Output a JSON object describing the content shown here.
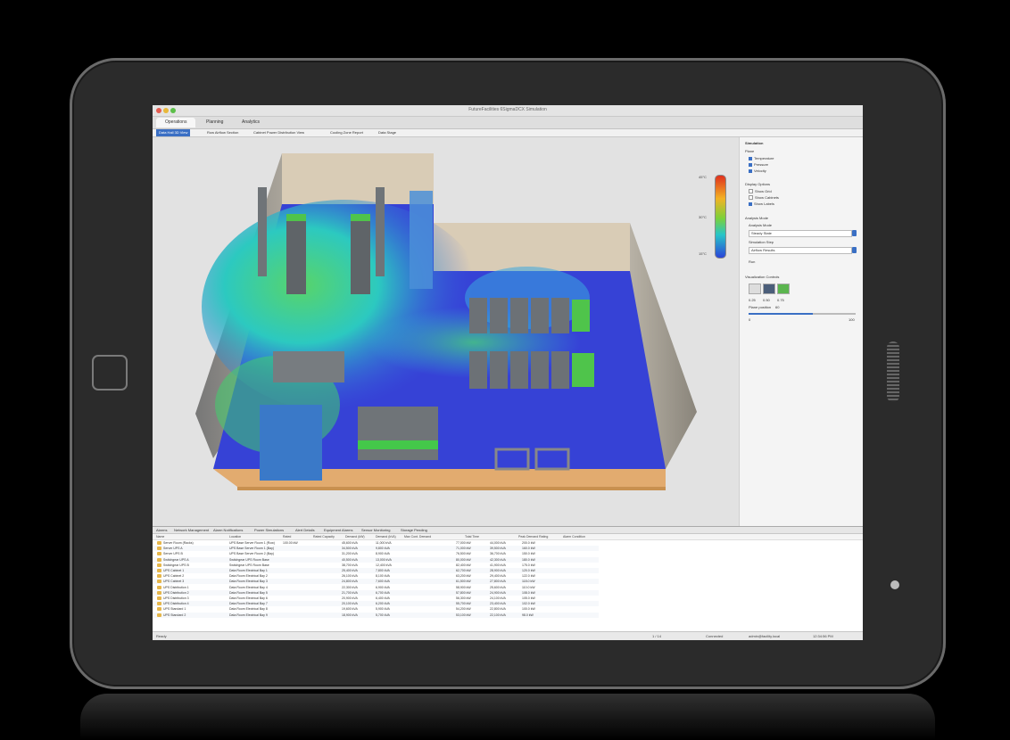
{
  "app": {
    "title": "FutureFacilities 6SigmaDCX Simulation"
  },
  "tabs": [
    {
      "label": "Operations"
    },
    {
      "label": "Planning"
    },
    {
      "label": "Analytics"
    }
  ],
  "subtabs": [
    {
      "label": "Data Hall 3D View"
    },
    {
      "label": "Row Airflow Section"
    },
    {
      "label": "Cabinet Power Distribution View"
    },
    {
      "label": "Cooling Zone Report"
    },
    {
      "label": "Data Stage"
    }
  ],
  "legend": {
    "max": "45°C",
    "mid": "30°C",
    "min": "15°C"
  },
  "right_panel": {
    "heading": "Simulation",
    "group1_title": "Plane",
    "checks": [
      {
        "label": "Temperature",
        "checked": true
      },
      {
        "label": "Pressure",
        "checked": true
      },
      {
        "label": "Velocity",
        "checked": true
      }
    ],
    "group2_title": "Display Options",
    "checks2": [
      {
        "label": "Show Grid",
        "checked": false
      },
      {
        "label": "Show Cabinets",
        "checked": false
      },
      {
        "label": "Show Labels",
        "checked": true
      }
    ],
    "group3_title": "Analysis Mode",
    "field1_label": "Analysis Mode",
    "field1_value": "Steady State",
    "field2_label": "Simulation Step",
    "field2_value": "Airflow Results",
    "run_label": "Run",
    "group4_title": "Visualization Controls",
    "scale_labels": [
      "0.25",
      "0.50",
      "0.75"
    ],
    "plane_label": "Plane position",
    "plane_value": "60",
    "range_min": "0",
    "range_max": "100"
  },
  "bottom": {
    "tabs": [
      "Alarms",
      "Network Management",
      "Alarm Notifications",
      "Power Simulations",
      "Alert Details",
      "Equipment Alarms",
      "Sensor Monitoring",
      "Storage Pending"
    ],
    "headers": [
      "Name",
      "Location",
      "Rated",
      "Rated Capacity",
      "Demand (kW)",
      "Demand (kVA)",
      "Max Cont. Demand",
      "Total Time",
      "Peak Demand Rating",
      "Alarm Condition"
    ],
    "rows": [
      {
        "name": "Server Room (Racks)",
        "loc": "UPS Base Server Room 1 (Row)",
        "rated": "100.00 kW",
        "cap": "45,600 kVA",
        "d1": "11,000 kVA",
        "d2": "77,000 kW",
        "d3": "44,000 kVA",
        "d4": "200.0 kW"
      },
      {
        "name": "Server UPS A",
        "loc": "UPS Base Server Room 1 (Bay)",
        "rated": "",
        "cap": "34,500 kVA",
        "d1": "9,800 kVA",
        "d2": "71,000 kW",
        "d3": "39,500 kVA",
        "d4": "160.0 kW"
      },
      {
        "name": "Server UPS B",
        "loc": "UPS Base Server Room 2 (Bay)",
        "rated": "",
        "cap": "31,200 kVA",
        "d1": "8,900 kVA",
        "d2": "76,500 kW",
        "d3": "36,700 kVA",
        "d4": "150.0 kW"
      },
      {
        "name": "Switchgear UPS A",
        "loc": "Switchgear UPS Room Base",
        "rated": "",
        "cap": "40,500 kVA",
        "d1": "13,000 kVA",
        "d2": "80,000 kW",
        "d3": "42,300 kVA",
        "d4": "180.0 kW"
      },
      {
        "name": "Switchgear UPS B",
        "loc": "Switchgear UPS Room Base",
        "rated": "",
        "cap": "38,700 kVA",
        "d1": "12,400 kVA",
        "d2": "82,400 kW",
        "d3": "41,900 kVA",
        "d4": "175.0 kW"
      },
      {
        "name": "UPS Cabinet 1",
        "loc": "Data Room Electrical Bay 1",
        "rated": "",
        "cap": "25,400 kVA",
        "d1": "7,800 kVA",
        "d2": "62,700 kW",
        "d3": "28,900 kVA",
        "d4": "120.0 kW"
      },
      {
        "name": "UPS Cabinet 2",
        "loc": "Data Room Electrical Bay 2",
        "rated": "",
        "cap": "26,100 kVA",
        "d1": "8,100 kVA",
        "d2": "63,200 kW",
        "d3": "29,400 kVA",
        "d4": "122.0 kW"
      },
      {
        "name": "UPS Cabinet 3",
        "loc": "Data Room Electrical Bay 3",
        "rated": "",
        "cap": "24,800 kVA",
        "d1": "7,600 kVA",
        "d2": "61,500 kW",
        "d3": "27,800 kVA",
        "d4": "118.0 kW"
      },
      {
        "name": "UPS Distribution 1",
        "loc": "Data Room Electrical Bay 4",
        "rated": "",
        "cap": "22,300 kVA",
        "d1": "6,900 kVA",
        "d2": "58,900 kW",
        "d3": "25,600 kVA",
        "d4": "110.0 kW"
      },
      {
        "name": "UPS Distribution 2",
        "loc": "Data Room Electrical Bay 5",
        "rated": "",
        "cap": "21,700 kVA",
        "d1": "6,700 kVA",
        "d2": "57,800 kW",
        "d3": "24,900 kVA",
        "d4": "108.0 kW"
      },
      {
        "name": "UPS Distribution 3",
        "loc": "Data Room Electrical Bay 6",
        "rated": "",
        "cap": "20,900 kVA",
        "d1": "6,400 kVA",
        "d2": "56,300 kW",
        "d3": "24,100 kVA",
        "d4": "105.0 kW"
      },
      {
        "name": "UPS Distribution 4",
        "loc": "Data Room Electrical Bay 7",
        "rated": "",
        "cap": "20,100 kVA",
        "d1": "6,200 kVA",
        "d2": "55,700 kW",
        "d3": "23,400 kVA",
        "d4": "102.0 kW"
      },
      {
        "name": "UPS Standard 1",
        "loc": "Data Room Electrical Bay 8",
        "rated": "",
        "cap": "19,600 kVA",
        "d1": "5,900 kVA",
        "d2": "54,200 kW",
        "d3": "22,800 kVA",
        "d4": "100.0 kW"
      },
      {
        "name": "UPS Standard 2",
        "loc": "Data Room Electrical Bay 9",
        "rated": "",
        "cap": "18,900 kVA",
        "d1": "5,700 kVA",
        "d2": "53,100 kW",
        "d3": "22,100 kVA",
        "d4": "98.0 kW"
      }
    ]
  },
  "status": {
    "left": "Ready",
    "count": "1 / 14",
    "warnings": "Connected",
    "user": "admin@facility.local",
    "time": "12:34:56 PM"
  }
}
